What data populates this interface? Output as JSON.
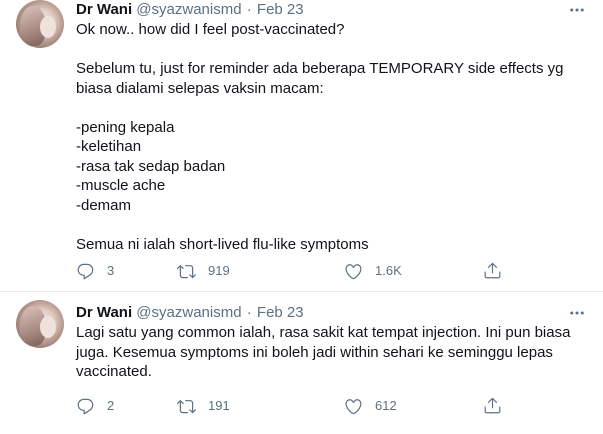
{
  "tweets": [
    {
      "author_name": "Dr Wani",
      "handle": "@syazwanismd",
      "separator": "·",
      "date": "Feb 23",
      "lines": [
        "Ok now.. how did I feel post-vaccinated?",
        "",
        "Sebelum tu, just for reminder ada beberapa TEMPORARY side effects yg",
        "biasa dialami selepas vaksin macam:",
        "",
        "-pening kepala",
        "-keletihan",
        "-rasa tak sedap badan",
        "-muscle ache",
        "-demam",
        "",
        "Semua ni ialah short-lived flu-like symptoms"
      ],
      "replies": "3",
      "retweets": "919",
      "likes": "1.6K"
    },
    {
      "author_name": "Dr Wani",
      "handle": "@syazwanismd",
      "separator": "·",
      "date": "Feb 23",
      "lines": [
        "Lagi satu yang common ialah, rasa sakit kat tempat injection. Ini pun biasa",
        "juga. Kesemua symptoms ini boleh jadi within sehari ke seminggu lepas",
        "vaccinated."
      ],
      "replies": "2",
      "retweets": "191",
      "likes": "612"
    }
  ],
  "icons": {
    "reply": "reply-icon",
    "retweet": "retweet-icon",
    "like": "heart-icon",
    "share": "share-icon",
    "more": "more-options-icon"
  },
  "colors": {
    "text": "#0f1419",
    "secondary": "#5b7083",
    "divider": "#e6ecf0"
  }
}
